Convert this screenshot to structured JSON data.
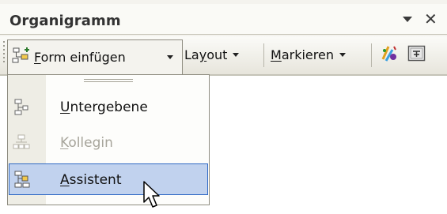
{
  "window": {
    "title": "Organigramm"
  },
  "toolbar": {
    "form_label_accel": "F",
    "form_label_rest": "orm einfügen",
    "layout_label_pre": "La",
    "layout_label_accel": "y",
    "layout_label_post": "out",
    "mark_label_accel": "M",
    "mark_label_rest": "arkieren"
  },
  "menu": {
    "items": [
      {
        "accel": "U",
        "rest": "ntergebene",
        "enabled": true
      },
      {
        "accel": "K",
        "rest": "ollegin",
        "enabled": false
      },
      {
        "accel": "A",
        "rest": "ssistent",
        "enabled": true,
        "highlighted": true
      }
    ]
  },
  "colors": {
    "highlight_fill": "#c1d2ee",
    "highlight_border": "#316ac5",
    "disabled_text": "#a7a59b"
  }
}
